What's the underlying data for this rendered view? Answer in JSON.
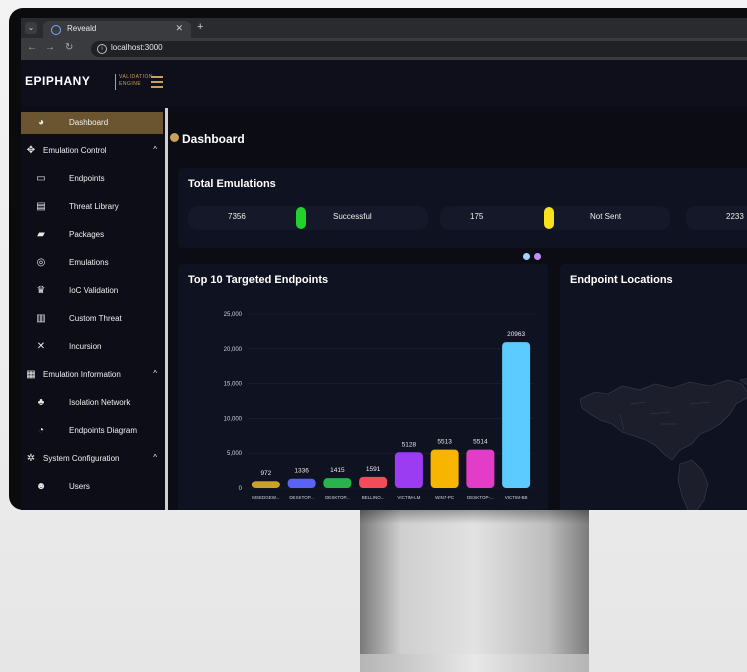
{
  "browser": {
    "tab_title": "Reveald",
    "url": "localhost:3000"
  },
  "app": {
    "logo": "EPIPHANY",
    "logo_sub_1": "VALIDATION",
    "logo_sub_2": "ENGINE"
  },
  "sidebar": {
    "items": [
      {
        "label": "Dashboard",
        "icon": "dashboard-icon",
        "glyph": "◕",
        "level": 1,
        "active": true
      },
      {
        "label": "Emulation Control",
        "icon": "move-icon",
        "glyph": "✥",
        "level": 0,
        "chevron": "^"
      },
      {
        "label": "Endpoints",
        "icon": "laptop-icon",
        "glyph": "▭",
        "level": 1
      },
      {
        "label": "Threat Library",
        "icon": "document-icon",
        "glyph": "▤",
        "level": 1
      },
      {
        "label": "Packages",
        "icon": "folder-icon",
        "glyph": "▰",
        "level": 1
      },
      {
        "label": "Emulations",
        "icon": "target-icon",
        "glyph": "◎",
        "level": 1
      },
      {
        "label": "IoC Validation",
        "icon": "crown-icon",
        "glyph": "♛",
        "level": 1
      },
      {
        "label": "Custom Threat",
        "icon": "file-icon",
        "glyph": "▥",
        "level": 1
      },
      {
        "label": "Incursion",
        "icon": "shuffle-icon",
        "glyph": "✕",
        "level": 1
      },
      {
        "label": "Emulation Information",
        "icon": "list-icon",
        "glyph": "▦",
        "level": 0,
        "chevron": "^"
      },
      {
        "label": "Isolation Network",
        "icon": "network-icon",
        "glyph": "♣",
        "level": 1
      },
      {
        "label": "Endpoints Diagram",
        "icon": "pie-icon",
        "glyph": "◔",
        "level": 1
      },
      {
        "label": "System Configuration",
        "icon": "gear-icon",
        "glyph": "✲",
        "level": 0,
        "chevron": "^"
      },
      {
        "label": "Users",
        "icon": "users-icon",
        "glyph": "☻",
        "level": 1
      }
    ]
  },
  "main": {
    "title": "Dashboard",
    "total_emulations": {
      "title": "Total Emulations",
      "stats": [
        {
          "value": "7356",
          "label": "Successful",
          "color": "#22d12c"
        },
        {
          "value": "175",
          "label": "Not Sent",
          "color": "#f7e21c"
        },
        {
          "value": "2233",
          "label": "",
          "color": "#ff4d4d"
        }
      ]
    },
    "top10_title": "Top 10 Targeted Endpoints",
    "locations_title": "Endpoint Locations",
    "legend_dots": [
      "#9fd6ff",
      "#c58cff"
    ]
  },
  "chart_data": {
    "type": "bar",
    "title": "Top 10 Targeted Endpoints",
    "categories": [
      "MSEDGEW...",
      "DESKTOP...",
      "DESKTOP...",
      "BELLINO...",
      "VICTIM-LM",
      "WIN7-PC",
      "DESKTOP-...",
      "VICTIM-BB"
    ],
    "values": [
      972,
      1336,
      1415,
      1591,
      5128,
      5513,
      5514,
      20963
    ],
    "colors": [
      "#c9a227",
      "#5b63f5",
      "#28b44a",
      "#f24b5a",
      "#9b3cf2",
      "#f7b500",
      "#e23cc8",
      "#5ccbff"
    ],
    "yticks": [
      "0",
      "5,000",
      "10,000",
      "15,000",
      "20,000",
      "25,000"
    ],
    "ylim": [
      0,
      25000
    ],
    "grid": true
  }
}
